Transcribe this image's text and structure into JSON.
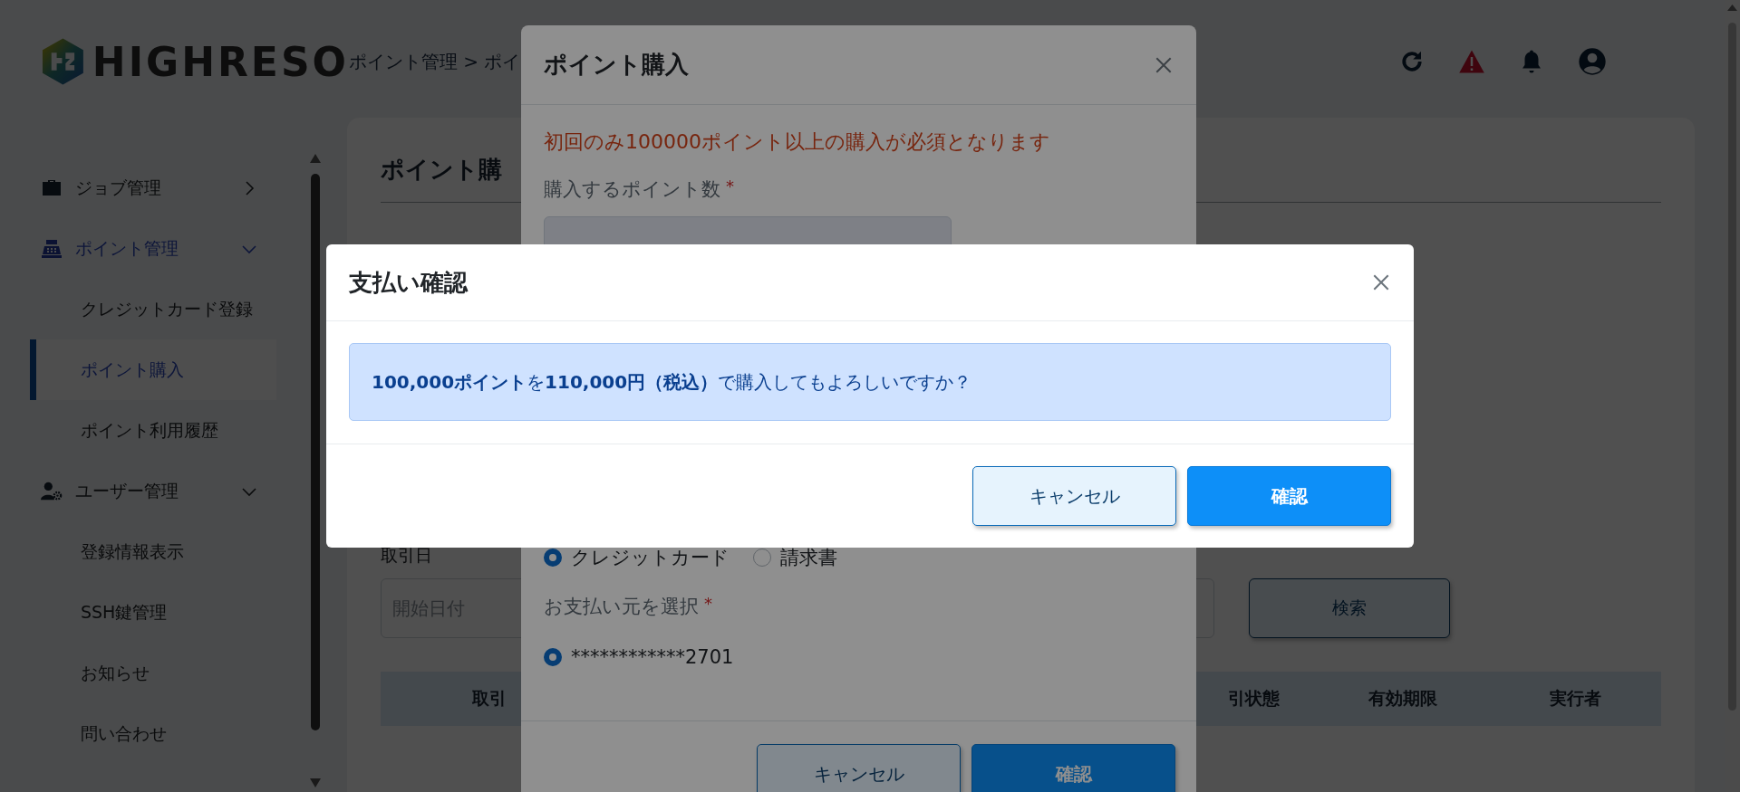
{
  "header": {
    "logo_text": "HIGHRESO",
    "breadcrumb": "ポイント管理 > ポイ"
  },
  "sidebar": {
    "items": [
      {
        "label": "ジョブ管理",
        "active": false,
        "expanded": false
      },
      {
        "label": "ポイント管理",
        "active": true,
        "expanded": true,
        "children": [
          {
            "label": "クレジットカード登録",
            "selected": false
          },
          {
            "label": "ポイント購入",
            "selected": true
          },
          {
            "label": "ポイント利用履歴",
            "selected": false
          }
        ]
      },
      {
        "label": "ユーザー管理",
        "active": false,
        "expanded": true,
        "children": [
          {
            "label": "登録情報表示",
            "selected": false
          },
          {
            "label": "SSH鍵管理",
            "selected": false
          },
          {
            "label": "お知らせ",
            "selected": false
          },
          {
            "label": "問い合わせ",
            "selected": false
          }
        ]
      }
    ]
  },
  "content": {
    "title": "ポイント購",
    "filter": {
      "label": "取引日",
      "date_field": {
        "placeholder": "開始日付"
      },
      "search_button": "検索"
    },
    "table": {
      "columns": [
        "取引",
        "",
        "引状態",
        "有効期限",
        "実行者"
      ]
    }
  },
  "purchase_modal": {
    "title": "ポイント購入",
    "notice": "初回のみ100000ポイント以上の購入が必須となります",
    "points_label": {
      "text": "購入するポイント数",
      "mark": "*"
    },
    "payment_methods": [
      {
        "label": "クレジットカード",
        "selected": true
      },
      {
        "label": "請求書",
        "selected": false
      }
    ],
    "source_label": {
      "text": "お支払い元を選択",
      "mark": "*"
    },
    "sources": [
      {
        "label": "************2701",
        "selected": true
      }
    ],
    "buttons": [
      {
        "label": "キャンセル",
        "kind": "secondary"
      },
      {
        "label": "確認",
        "kind": "primary"
      }
    ]
  },
  "confirm_dialog": {
    "title": "支払い確認",
    "message": "**100,000ポイント**を**110,000円（税込）**で購入してもよろしいですか？",
    "buttons": [
      {
        "label": "キャンセル",
        "kind": "secondary"
      },
      {
        "label": "確認",
        "kind": "primary"
      }
    ]
  }
}
